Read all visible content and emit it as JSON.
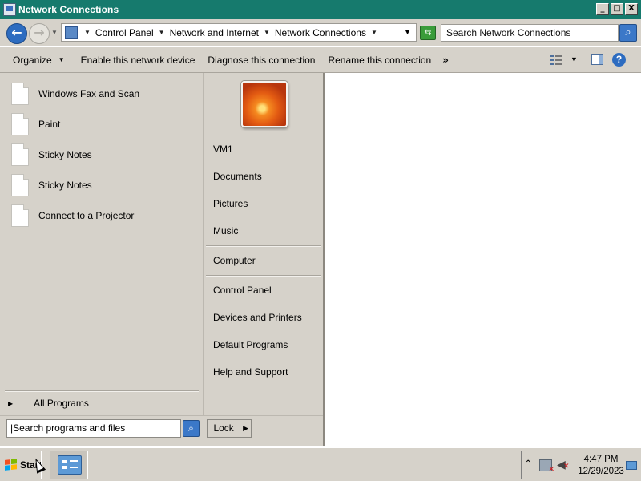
{
  "window": {
    "title": "Network Connections",
    "controls": {
      "minimize": "_",
      "maximize": "□",
      "close": "X"
    }
  },
  "address": {
    "breadcrumb": [
      "Control Panel",
      "Network and Internet",
      "Network Connections"
    ],
    "search_placeholder": "Search Network Connections"
  },
  "commandbar": {
    "organize": "Organize",
    "enable": "Enable this network device",
    "diagnose": "Diagnose this connection",
    "rename": "Rename this connection",
    "more": "»",
    "help": "?"
  },
  "startmenu": {
    "programs": [
      {
        "label": "Windows Fax and Scan"
      },
      {
        "label": "Paint"
      },
      {
        "label": "Sticky Notes"
      },
      {
        "label": "Sticky Notes"
      },
      {
        "label": "Connect to a Projector"
      }
    ],
    "all_programs": "All Programs",
    "search_placeholder": "Search programs and files",
    "right": {
      "user": "VM1",
      "documents": "Documents",
      "pictures": "Pictures",
      "music": "Music",
      "computer": "Computer",
      "control_panel": "Control Panel",
      "devices": "Devices and Printers",
      "default_programs": "Default Programs",
      "help": "Help and Support"
    },
    "lock": "Lock"
  },
  "taskbar": {
    "start_label": "Start",
    "time": "4:47 PM",
    "date": "12/29/2023"
  },
  "icons": {
    "back": "arrow-left-icon",
    "forward": "arrow-right-icon",
    "refresh": "refresh-icon",
    "search": "search-icon",
    "views": "views-icon",
    "preview_pane": "preview-pane-icon",
    "help": "help-icon",
    "network_tray": "network-icon",
    "volume": "volume-muted-icon"
  },
  "colors": {
    "titlebar": "#167a6d",
    "chrome": "#d6d2ca",
    "accent_blue": "#2d6cc0"
  }
}
